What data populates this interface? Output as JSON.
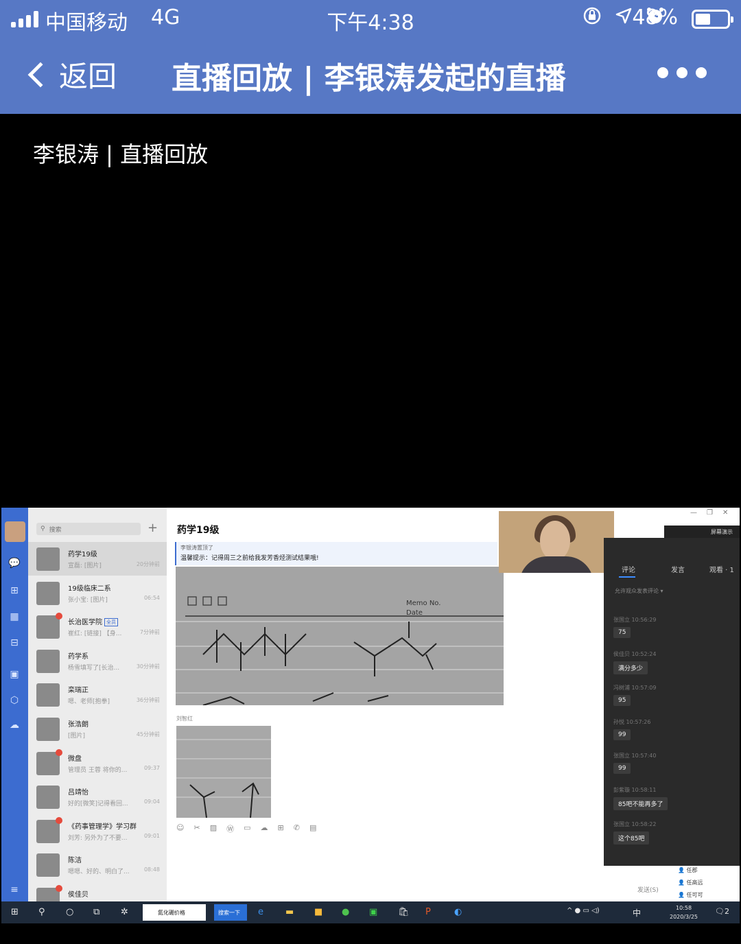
{
  "status_bar": {
    "carrier": "中国移动",
    "network": "4G",
    "time": "下午4:38",
    "battery_percent": "48%",
    "battery_level": 0.48,
    "icons": [
      "signal-icon",
      "rotation-lock-icon",
      "location-icon",
      "alarm-icon",
      "battery-icon"
    ]
  },
  "nav": {
    "back_label": "返回",
    "title": "直播回放 | 李银涛发起的直播",
    "more_icon": "more-icon"
  },
  "video": {
    "caption": "李银涛 | 直播回放"
  },
  "shared_screen": {
    "search_placeholder": "搜索",
    "conversations": [
      {
        "name": "药学19级",
        "preview": "宣磊: [图片]",
        "time": "20分钟前",
        "badge": false
      },
      {
        "name": "19级临床二系",
        "preview": "张小宝: [图片]",
        "time": "06:54",
        "badge": false
      },
      {
        "name": "长治医学院",
        "tag": "全员",
        "preview": "崔红: [链接] 【身...",
        "time": "7分钟前",
        "badge": true
      },
      {
        "name": "药学系",
        "preview": "杨雪填写了[长治...",
        "time": "30分钟前",
        "badge": false
      },
      {
        "name": "栾瑞正",
        "preview": "嗯、老师[抱拳]",
        "time": "36分钟前",
        "badge": false
      },
      {
        "name": "张浩朗",
        "preview": "[图片]",
        "time": "45分钟前",
        "badge": false
      },
      {
        "name": "微盘",
        "preview": "管理员 王蓉 将你的...",
        "time": "09:37",
        "badge": true
      },
      {
        "name": "吕靖怡",
        "preview": "好的[微笑]记得看回...",
        "time": "09:04",
        "badge": false
      },
      {
        "name": "《药事管理学》学习群",
        "preview": "刘芳: 另外为了不要...",
        "time": "09:01",
        "badge": true
      },
      {
        "name": "陈洁",
        "preview": "嗯嗯、好的、明白了...",
        "time": "08:48",
        "badge": false
      },
      {
        "name": "侯佳贝",
        "preview": "",
        "time": "",
        "badge": true
      }
    ],
    "chat": {
      "title": "药学19级",
      "pinned_by": "李银涛置顶了",
      "pinned_text": "温馨提示：记得周三之前给我发芳香烃测试结果哦!",
      "photo_text": {
        "memo": "Memo No.",
        "date": "Date"
      },
      "second_sender": "刘智红",
      "send_label": "发送(S)"
    },
    "comments_panel": {
      "tabs": [
        "评论",
        "发言",
        "观看 · 1"
      ],
      "allow_text": "允许观众发表评论 ▾",
      "share_label": "屏幕演示",
      "comments": [
        {
          "user": "张国立",
          "time": "10:56:29",
          "text": "75"
        },
        {
          "user": "侯佳贝",
          "time": "10:52:24",
          "text": "满分多少"
        },
        {
          "user": "冯树浦",
          "time": "10:57:09",
          "text": "95"
        },
        {
          "user": "孙悦",
          "time": "10:57:26",
          "text": "99"
        },
        {
          "user": "张国立",
          "time": "10:57:40",
          "text": "99"
        },
        {
          "user": "彭紫璇",
          "time": "10:58:11",
          "text": "85吧不能再多了"
        },
        {
          "user": "张国立",
          "time": "10:58:22",
          "text": "这个85吧"
        }
      ],
      "viewers": [
        "任郡",
        "任高远",
        "任可可"
      ]
    },
    "taskbar": {
      "search_text": "氮化硼价格",
      "search_button": "搜索一下",
      "ime": "中",
      "clock_time": "10:58",
      "clock_date": "2020/3/25",
      "notification_count": "2"
    }
  }
}
